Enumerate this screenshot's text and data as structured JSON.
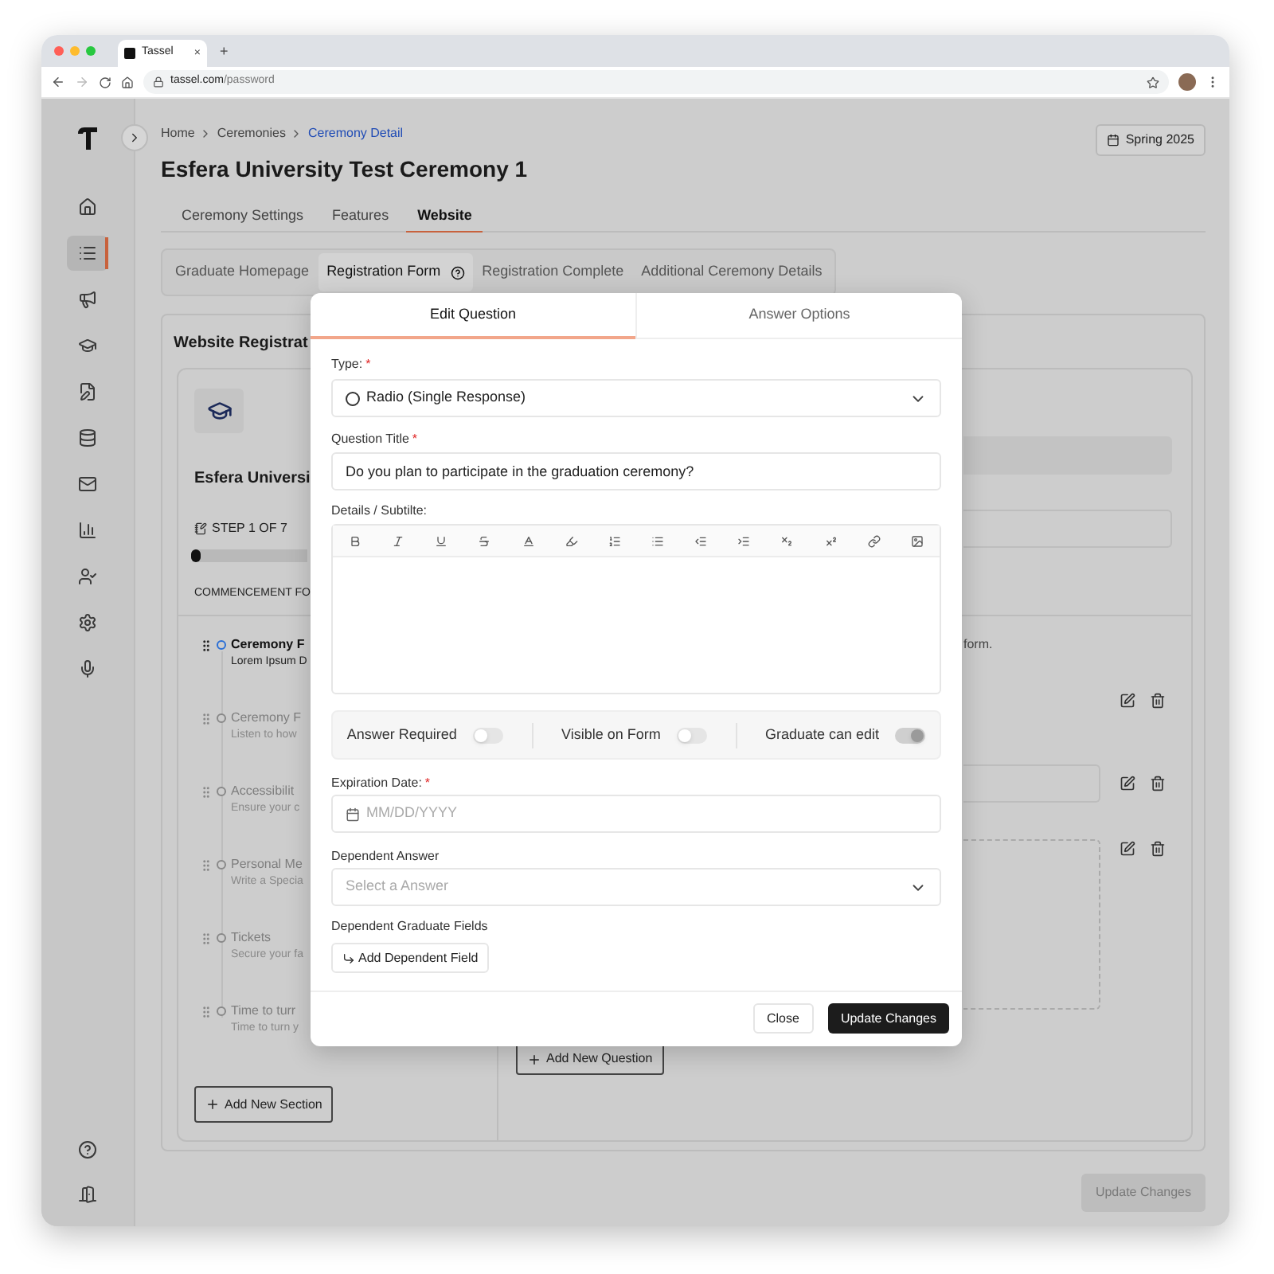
{
  "browser": {
    "tab_title": "Tassel",
    "new_tab": "+",
    "tab_close": "×",
    "url_host": "tassel.com",
    "url_path": "/password"
  },
  "sidebar": {
    "top_items": [
      {
        "kind": "home",
        "selected": false
      },
      {
        "kind": "list",
        "selected": true
      },
      {
        "kind": "megaphone",
        "selected": false
      },
      {
        "kind": "graduation",
        "selected": false
      },
      {
        "kind": "form",
        "selected": false
      },
      {
        "kind": "database",
        "selected": false
      },
      {
        "kind": "mail",
        "selected": false
      },
      {
        "kind": "chart",
        "selected": false
      },
      {
        "kind": "user",
        "selected": false
      },
      {
        "kind": "settings",
        "selected": false
      },
      {
        "kind": "mic",
        "selected": false
      }
    ],
    "bottom_items": [
      {
        "kind": "help",
        "selected": false
      },
      {
        "kind": "exit",
        "selected": false
      }
    ]
  },
  "breadcrumb": [
    {
      "label": "Home",
      "current": false
    },
    {
      "label": "Ceremonies",
      "current": false
    },
    {
      "label": "Ceremony Detail",
      "current": true
    }
  ],
  "page_title": "Esfera University Test Ceremony 1",
  "term_button": "Spring 2025",
  "tabs": [
    {
      "label": "Ceremony Settings",
      "selected": false
    },
    {
      "label": "Features",
      "selected": false
    },
    {
      "label": "Website",
      "selected": true
    }
  ],
  "subtabs": [
    {
      "label": "Graduate Homepage",
      "selected": false,
      "help": false
    },
    {
      "label": "Registration Form",
      "selected": true,
      "help": true
    },
    {
      "label": "Registration Complete",
      "selected": false,
      "help": false
    },
    {
      "label": "Additional Ceremony Details",
      "selected": false,
      "help": false
    }
  ],
  "section": {
    "title": "Website Registrat",
    "form_title": "Esfera Universi",
    "step": "STEP 1 OF 7",
    "progress": {
      "level": 0.08
    },
    "subheading": "COMMENCEMENT FO",
    "items": [
      {
        "title": "Ceremony F",
        "subtitle": "Lorem Ipsum D",
        "selected": true
      },
      {
        "title": "Ceremony F",
        "subtitle": "Listen to how",
        "selected": false
      },
      {
        "title": "Accessibilit",
        "subtitle": "Ensure your c",
        "selected": false
      },
      {
        "title": "Personal Me",
        "subtitle": "Write a Specia",
        "selected": false
      },
      {
        "title": "Tickets",
        "subtitle": "Secure your fa",
        "selected": false
      },
      {
        "title": "Time to turr",
        "subtitle": "Time to turn y",
        "selected": false
      }
    ],
    "add_section": "Add New Section"
  },
  "questions": {
    "note": "form.",
    "add_question": "Add New Question"
  },
  "footer_button": {
    "label": "Update Changes",
    "disabled": true
  },
  "modal": {
    "tabs": [
      {
        "label": "Edit Question",
        "selected": true
      },
      {
        "label": "Answer Options",
        "selected": false
      }
    ],
    "fields": [
      {
        "kind": "select",
        "label": "Type:",
        "required": true,
        "value": "Radio (Single Response)"
      },
      {
        "kind": "text",
        "label": "Question Title",
        "required": true,
        "value": "Do you plan to participate in the graduation ceremony?"
      },
      {
        "kind": "editor",
        "label": "Details / Subtilte:",
        "required": false
      },
      {
        "kind": "toggles",
        "toggles": [
          {
            "label": "Answer Required",
            "on": false,
            "disabled": false
          },
          {
            "label": "Visible on Form",
            "on": false,
            "disabled": false
          },
          {
            "label": "Graduate can edit",
            "on": true,
            "disabled": true
          }
        ]
      },
      {
        "kind": "date",
        "label": "Expiration Date:",
        "required": true,
        "placeholder": "MM/DD/YYYY"
      },
      {
        "kind": "select_empty",
        "label": "Dependent Answer",
        "required": false,
        "placeholder": "Select a Answer"
      },
      {
        "kind": "button",
        "label": "Dependent Graduate Fields",
        "required": false,
        "button": "Add Dependent Field"
      }
    ],
    "required_mark": "*",
    "close": "Close",
    "submit": "Update Changes"
  }
}
